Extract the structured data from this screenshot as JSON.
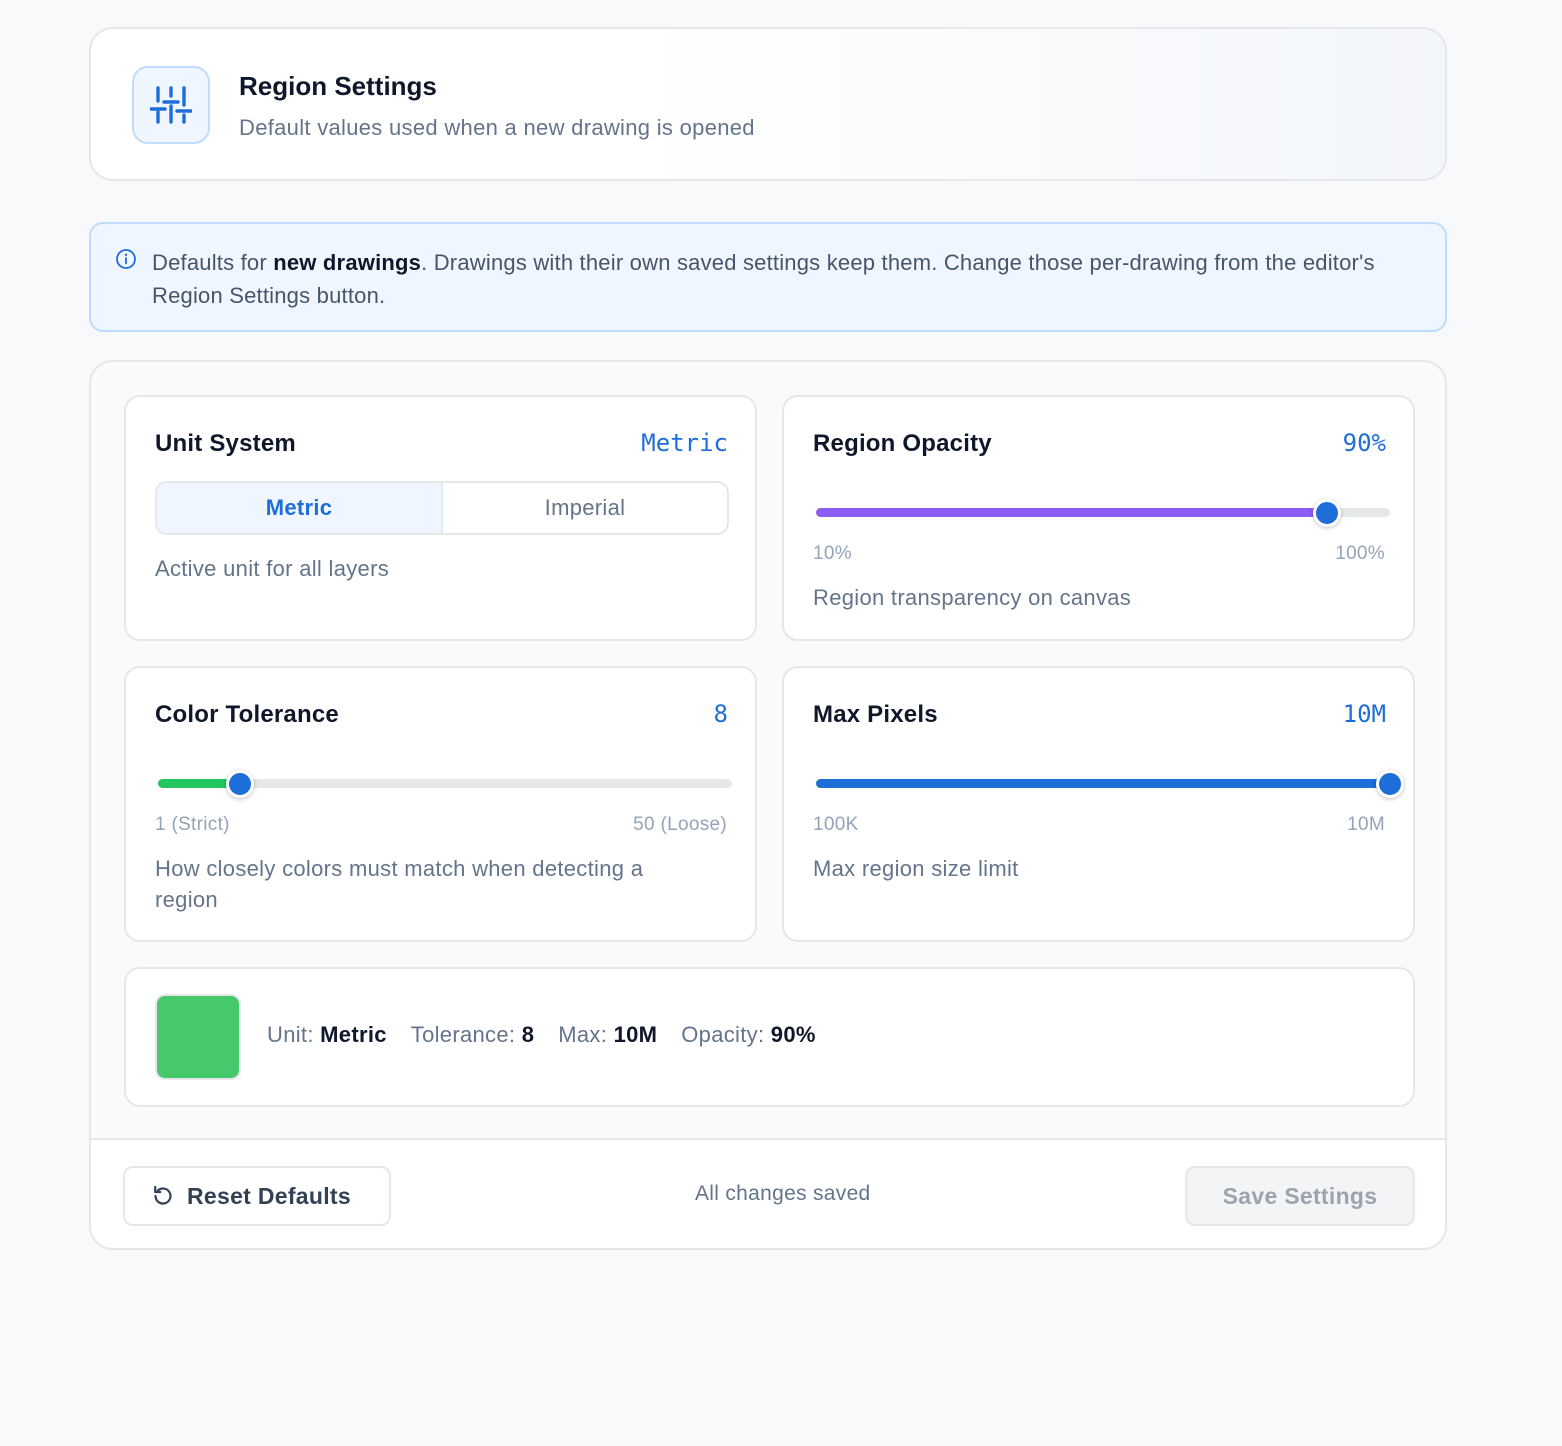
{
  "header": {
    "title": "Region Settings",
    "subtitle": "Default values used when a new drawing is opened",
    "icon": "sliders-icon"
  },
  "info": {
    "icon": "info-icon",
    "prefix": "Defaults for ",
    "emphasis": "new drawings",
    "suffix": ". Drawings with their own saved settings keep them. Change those per-drawing from the editor's Region Settings button."
  },
  "unit_system": {
    "title": "Unit System",
    "value": "Metric",
    "options": [
      "Metric",
      "Imperial"
    ],
    "selected": "Metric",
    "description": "Active unit for all layers"
  },
  "region_opacity": {
    "title": "Region Opacity",
    "value": "90%",
    "min_label": "10%",
    "max_label": "100%",
    "level": 0.89,
    "description": "Region transparency on canvas",
    "color": "#8b5cf6"
  },
  "color_tolerance": {
    "title": "Color Tolerance",
    "value": "8",
    "min_label": "1 (Strict)",
    "max_label": "50 (Loose)",
    "level": 0.143,
    "description": "How closely colors must match when detecting a region",
    "color": "#22c55e"
  },
  "max_pixels": {
    "title": "Max Pixels",
    "value": "10M",
    "min_label": "100K",
    "max_label": "10M",
    "level": 1.0,
    "description": "Max region size limit",
    "color": "#1d6ed8"
  },
  "summary": {
    "swatch_color": "#45c96a",
    "unit_label": "Unit:",
    "unit_value": "Metric",
    "tolerance_label": "Tolerance:",
    "tolerance_value": "8",
    "max_label": "Max:",
    "max_value": "10M",
    "opacity_label": "Opacity:",
    "opacity_value": "90%"
  },
  "footer": {
    "reset_label": "Reset Defaults",
    "reset_icon": "reset-icon",
    "status": "All changes saved",
    "save_label": "Save Settings"
  },
  "colors": {
    "accent": "#1d6ed8",
    "thumb": "#1d6ed8"
  }
}
